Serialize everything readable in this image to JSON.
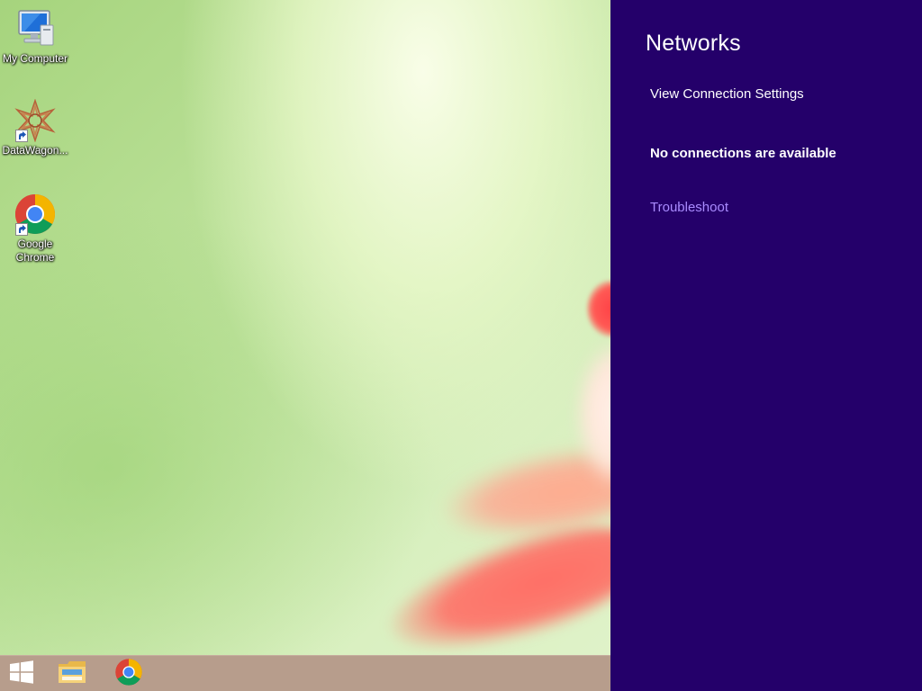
{
  "desktop": {
    "icons": [
      {
        "label": "My Computer",
        "icon": "computer-icon"
      },
      {
        "label": "DataWagon...",
        "icon": "datawagon-icon"
      },
      {
        "label": "Google Chrome",
        "icon": "chrome-icon"
      }
    ]
  },
  "taskbar": {
    "items": [
      {
        "icon": "windows-start-icon"
      },
      {
        "icon": "file-explorer-icon"
      },
      {
        "icon": "chrome-icon"
      }
    ]
  },
  "networks_pane": {
    "title": "Networks",
    "view_settings_label": "View Connection Settings",
    "status_text": "No connections are available",
    "troubleshoot_label": "Troubleshoot"
  },
  "colors": {
    "pane_background": "#24006a",
    "link_accent": "#a98bff",
    "taskbar_background": "#b79d8c"
  }
}
